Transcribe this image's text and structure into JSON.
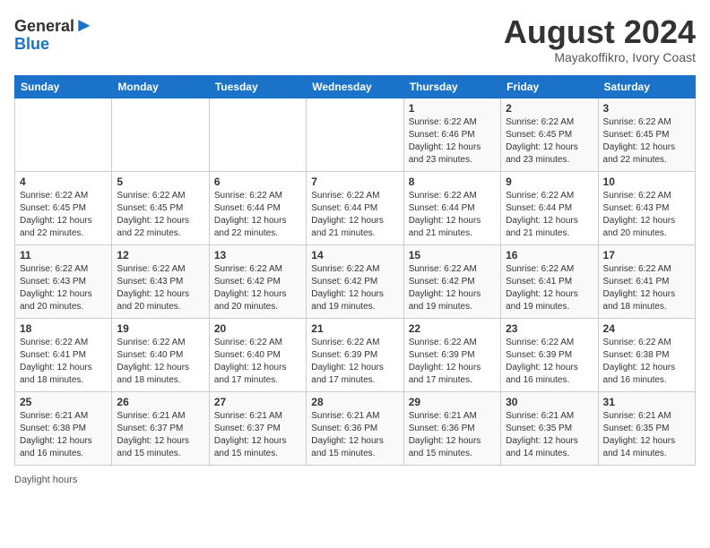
{
  "header": {
    "logo_line1": "General",
    "logo_line2": "Blue",
    "month_title": "August 2024",
    "location": "Mayakoffikro, Ivory Coast"
  },
  "days_of_week": [
    "Sunday",
    "Monday",
    "Tuesday",
    "Wednesday",
    "Thursday",
    "Friday",
    "Saturday"
  ],
  "weeks": [
    [
      {
        "day": "",
        "info": ""
      },
      {
        "day": "",
        "info": ""
      },
      {
        "day": "",
        "info": ""
      },
      {
        "day": "",
        "info": ""
      },
      {
        "day": "1",
        "info": "Sunrise: 6:22 AM\nSunset: 6:46 PM\nDaylight: 12 hours\nand 23 minutes."
      },
      {
        "day": "2",
        "info": "Sunrise: 6:22 AM\nSunset: 6:45 PM\nDaylight: 12 hours\nand 23 minutes."
      },
      {
        "day": "3",
        "info": "Sunrise: 6:22 AM\nSunset: 6:45 PM\nDaylight: 12 hours\nand 22 minutes."
      }
    ],
    [
      {
        "day": "4",
        "info": "Sunrise: 6:22 AM\nSunset: 6:45 PM\nDaylight: 12 hours\nand 22 minutes."
      },
      {
        "day": "5",
        "info": "Sunrise: 6:22 AM\nSunset: 6:45 PM\nDaylight: 12 hours\nand 22 minutes."
      },
      {
        "day": "6",
        "info": "Sunrise: 6:22 AM\nSunset: 6:44 PM\nDaylight: 12 hours\nand 22 minutes."
      },
      {
        "day": "7",
        "info": "Sunrise: 6:22 AM\nSunset: 6:44 PM\nDaylight: 12 hours\nand 21 minutes."
      },
      {
        "day": "8",
        "info": "Sunrise: 6:22 AM\nSunset: 6:44 PM\nDaylight: 12 hours\nand 21 minutes."
      },
      {
        "day": "9",
        "info": "Sunrise: 6:22 AM\nSunset: 6:44 PM\nDaylight: 12 hours\nand 21 minutes."
      },
      {
        "day": "10",
        "info": "Sunrise: 6:22 AM\nSunset: 6:43 PM\nDaylight: 12 hours\nand 20 minutes."
      }
    ],
    [
      {
        "day": "11",
        "info": "Sunrise: 6:22 AM\nSunset: 6:43 PM\nDaylight: 12 hours\nand 20 minutes."
      },
      {
        "day": "12",
        "info": "Sunrise: 6:22 AM\nSunset: 6:43 PM\nDaylight: 12 hours\nand 20 minutes."
      },
      {
        "day": "13",
        "info": "Sunrise: 6:22 AM\nSunset: 6:42 PM\nDaylight: 12 hours\nand 20 minutes."
      },
      {
        "day": "14",
        "info": "Sunrise: 6:22 AM\nSunset: 6:42 PM\nDaylight: 12 hours\nand 19 minutes."
      },
      {
        "day": "15",
        "info": "Sunrise: 6:22 AM\nSunset: 6:42 PM\nDaylight: 12 hours\nand 19 minutes."
      },
      {
        "day": "16",
        "info": "Sunrise: 6:22 AM\nSunset: 6:41 PM\nDaylight: 12 hours\nand 19 minutes."
      },
      {
        "day": "17",
        "info": "Sunrise: 6:22 AM\nSunset: 6:41 PM\nDaylight: 12 hours\nand 18 minutes."
      }
    ],
    [
      {
        "day": "18",
        "info": "Sunrise: 6:22 AM\nSunset: 6:41 PM\nDaylight: 12 hours\nand 18 minutes."
      },
      {
        "day": "19",
        "info": "Sunrise: 6:22 AM\nSunset: 6:40 PM\nDaylight: 12 hours\nand 18 minutes."
      },
      {
        "day": "20",
        "info": "Sunrise: 6:22 AM\nSunset: 6:40 PM\nDaylight: 12 hours\nand 17 minutes."
      },
      {
        "day": "21",
        "info": "Sunrise: 6:22 AM\nSunset: 6:39 PM\nDaylight: 12 hours\nand 17 minutes."
      },
      {
        "day": "22",
        "info": "Sunrise: 6:22 AM\nSunset: 6:39 PM\nDaylight: 12 hours\nand 17 minutes."
      },
      {
        "day": "23",
        "info": "Sunrise: 6:22 AM\nSunset: 6:39 PM\nDaylight: 12 hours\nand 16 minutes."
      },
      {
        "day": "24",
        "info": "Sunrise: 6:22 AM\nSunset: 6:38 PM\nDaylight: 12 hours\nand 16 minutes."
      }
    ],
    [
      {
        "day": "25",
        "info": "Sunrise: 6:21 AM\nSunset: 6:38 PM\nDaylight: 12 hours\nand 16 minutes."
      },
      {
        "day": "26",
        "info": "Sunrise: 6:21 AM\nSunset: 6:37 PM\nDaylight: 12 hours\nand 15 minutes."
      },
      {
        "day": "27",
        "info": "Sunrise: 6:21 AM\nSunset: 6:37 PM\nDaylight: 12 hours\nand 15 minutes."
      },
      {
        "day": "28",
        "info": "Sunrise: 6:21 AM\nSunset: 6:36 PM\nDaylight: 12 hours\nand 15 minutes."
      },
      {
        "day": "29",
        "info": "Sunrise: 6:21 AM\nSunset: 6:36 PM\nDaylight: 12 hours\nand 15 minutes."
      },
      {
        "day": "30",
        "info": "Sunrise: 6:21 AM\nSunset: 6:35 PM\nDaylight: 12 hours\nand 14 minutes."
      },
      {
        "day": "31",
        "info": "Sunrise: 6:21 AM\nSunset: 6:35 PM\nDaylight: 12 hours\nand 14 minutes."
      }
    ]
  ],
  "footer": {
    "label": "Daylight hours"
  }
}
